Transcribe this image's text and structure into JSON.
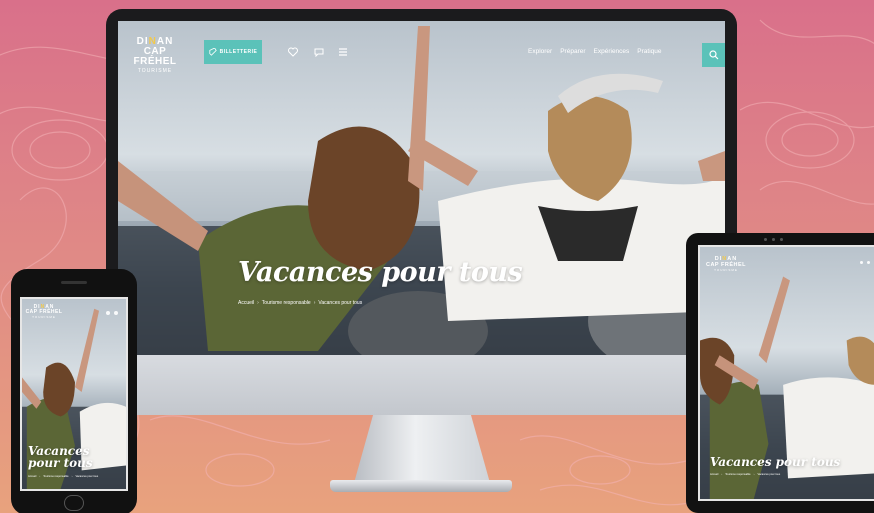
{
  "site": {
    "logo": {
      "line1_a": "DI",
      "line1_b": "N",
      "line1_c": "AN",
      "line2": "CAP FRÉHEL",
      "line3": "TOURISME"
    },
    "header": {
      "ticket_label": "BILLETTERIE"
    },
    "nav": [
      "Explorer",
      "Préparer",
      "Expériences",
      "Pratique"
    ],
    "hero": {
      "title": "Vacances pour tous",
      "breadcrumb": [
        "Accueil",
        "Tourisme responsable",
        "Vacances pour tous"
      ]
    }
  },
  "icons": {
    "ticket": "ticket-icon",
    "favorites": "heart-icon",
    "chat": "chat-icon",
    "menu": "hamburger-menu-icon",
    "search": "search-icon"
  },
  "colors": {
    "accent_teal": "#5bc2b9",
    "accent_yellow": "#f2c94c",
    "background_top": "#d9708a",
    "background_bottom": "#e8a27d"
  }
}
